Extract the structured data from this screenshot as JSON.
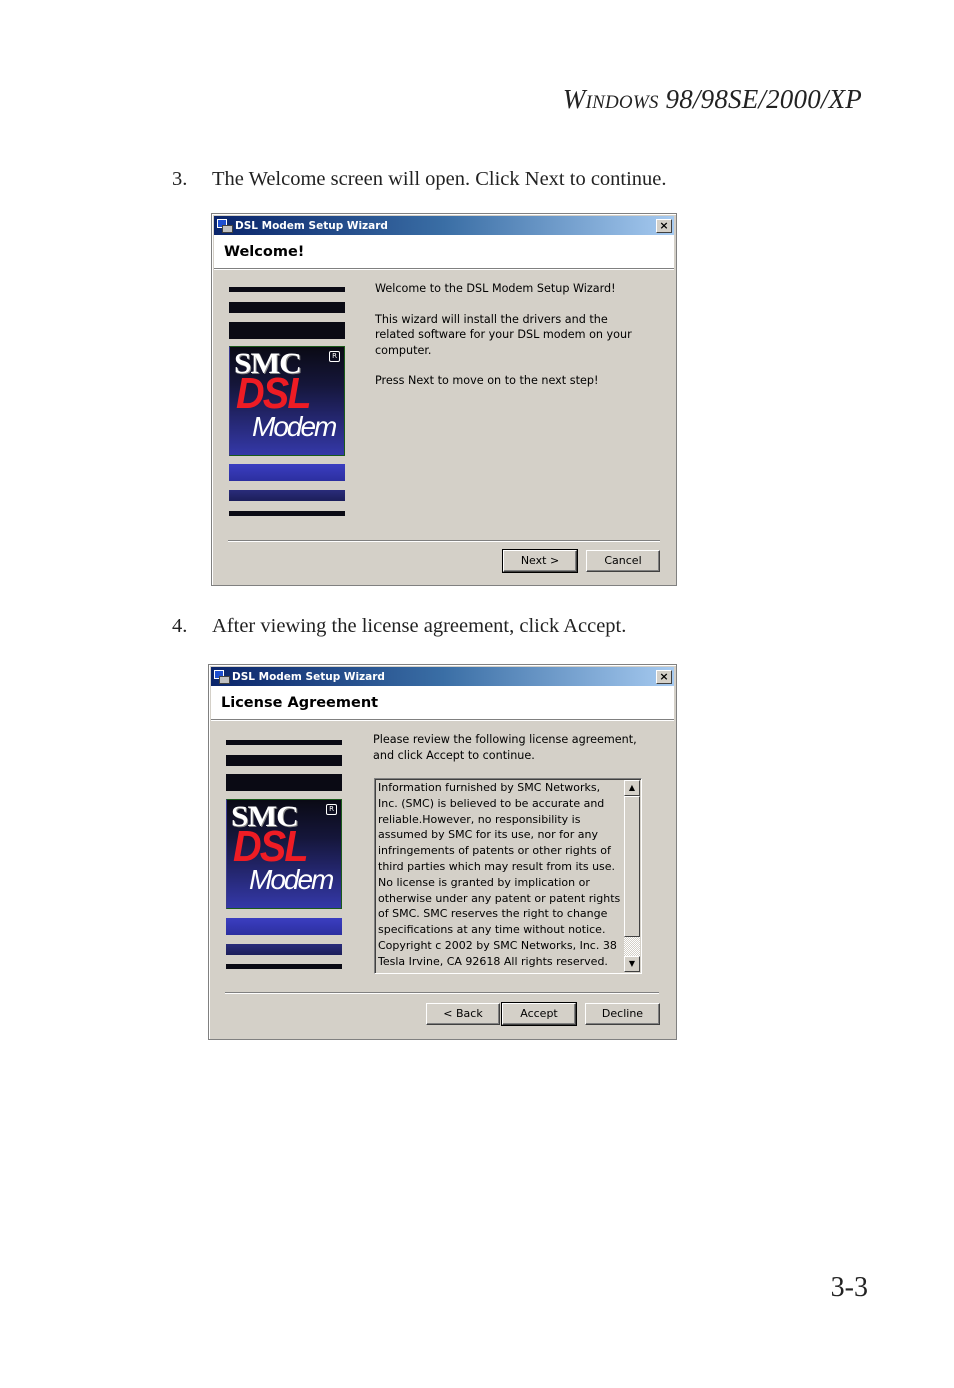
{
  "page": {
    "running_head": {
      "first_letter": "W",
      "small_caps": "indows",
      "rest": " 98/98SE/2000/XP"
    },
    "page_number": "3-3",
    "steps": [
      {
        "number": "3.",
        "text": "The Welcome screen will open. Click Next to continue."
      },
      {
        "number": "4.",
        "text": "After viewing the license agreement, click Accept."
      }
    ]
  },
  "dialogs": {
    "welcome": {
      "window_title": "DSL Modem Setup Wizard",
      "close_glyph": "×",
      "header_title": "Welcome!",
      "paragraphs": [
        "Welcome to the DSL Modem Setup Wizard!",
        "This wizard will install the drivers and the related software for your DSL modem on your computer.",
        "Press Next to move on to the next step!"
      ],
      "buttons": {
        "next": "Next >",
        "cancel": "Cancel"
      },
      "default_button": "next"
    },
    "license": {
      "window_title": "DSL Modem Setup Wizard",
      "close_glyph": "×",
      "header_title": "License Agreement",
      "instruction": "Please review the following license agreement, and click Accept to continue.",
      "license_text": "Information furnished by SMC Networks,\nInc. (SMC) is believed to be accurate and\nreliable.However, no responsibility is\nassumed by SMC for its use, nor for any\ninfringements of patents or other rights of\nthird parties which may result from its use.\nNo license is granted by implication or\notherwise under any patent or patent rights\nof SMC. SMC reserves the right to change\nspecifications at any time without notice.\nCopyright c 2002 by SMC Networks, Inc. 38\nTesla Irvine, CA 92618  All rights reserved.",
      "scroll": {
        "up_glyph": "▲",
        "down_glyph": "▼",
        "thumb_fraction": 0.88,
        "position_fraction": 1.0
      },
      "buttons": {
        "back": "< Back",
        "accept": "Accept",
        "decline": "Decline"
      },
      "default_button": "accept"
    },
    "logo": {
      "brand": "SMC",
      "registered": "R",
      "product": "DSL",
      "subtitle": "Modem"
    }
  }
}
